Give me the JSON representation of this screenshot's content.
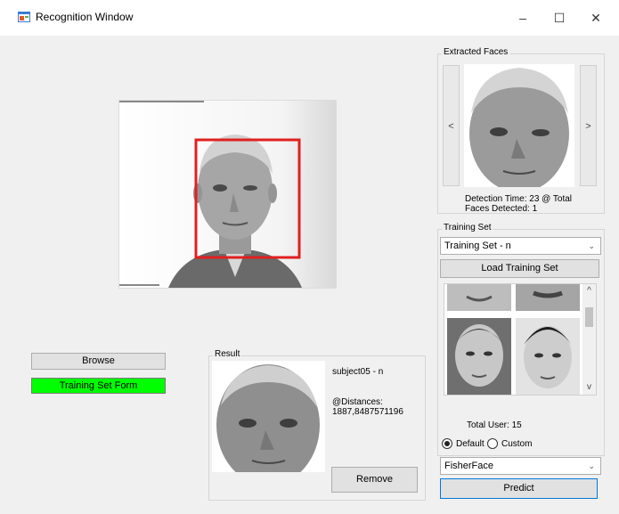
{
  "window": {
    "title": "Recognition Window"
  },
  "controls": {
    "minimize": "–",
    "maximize": "☐",
    "close": "✕"
  },
  "left": {
    "browse_label": "Browse",
    "training_set_form_label": "Training Set Form"
  },
  "result": {
    "group_label": "Result",
    "subject": "subject05 - n",
    "distances_label": "@Distances:",
    "distances_value": "1887,8487571196",
    "remove_label": "Remove"
  },
  "extracted": {
    "group_label": "Extracted Faces",
    "prev": "<",
    "next": ">",
    "detection_time": "Detection Time: 23 @ Total",
    "faces_detected": "Faces Detected: 1"
  },
  "training": {
    "group_label": "Training Set",
    "selected": "Training Set - n",
    "load_label": "Load Training Set",
    "total_users": "Total User: 15",
    "scroll_up": "^",
    "scroll_down": "v",
    "options": {
      "default_label": "Default",
      "custom_label": "Custom",
      "selected": "Default"
    },
    "algorithm": "FisherFace",
    "predict_label": "Predict"
  },
  "colors": {
    "accent_green": "#00ff00",
    "detection_box": "#e02020",
    "focus_border": "#0078d7"
  },
  "icons": {
    "app": "app-window-icon",
    "dropdown": "chevron-down-icon"
  }
}
